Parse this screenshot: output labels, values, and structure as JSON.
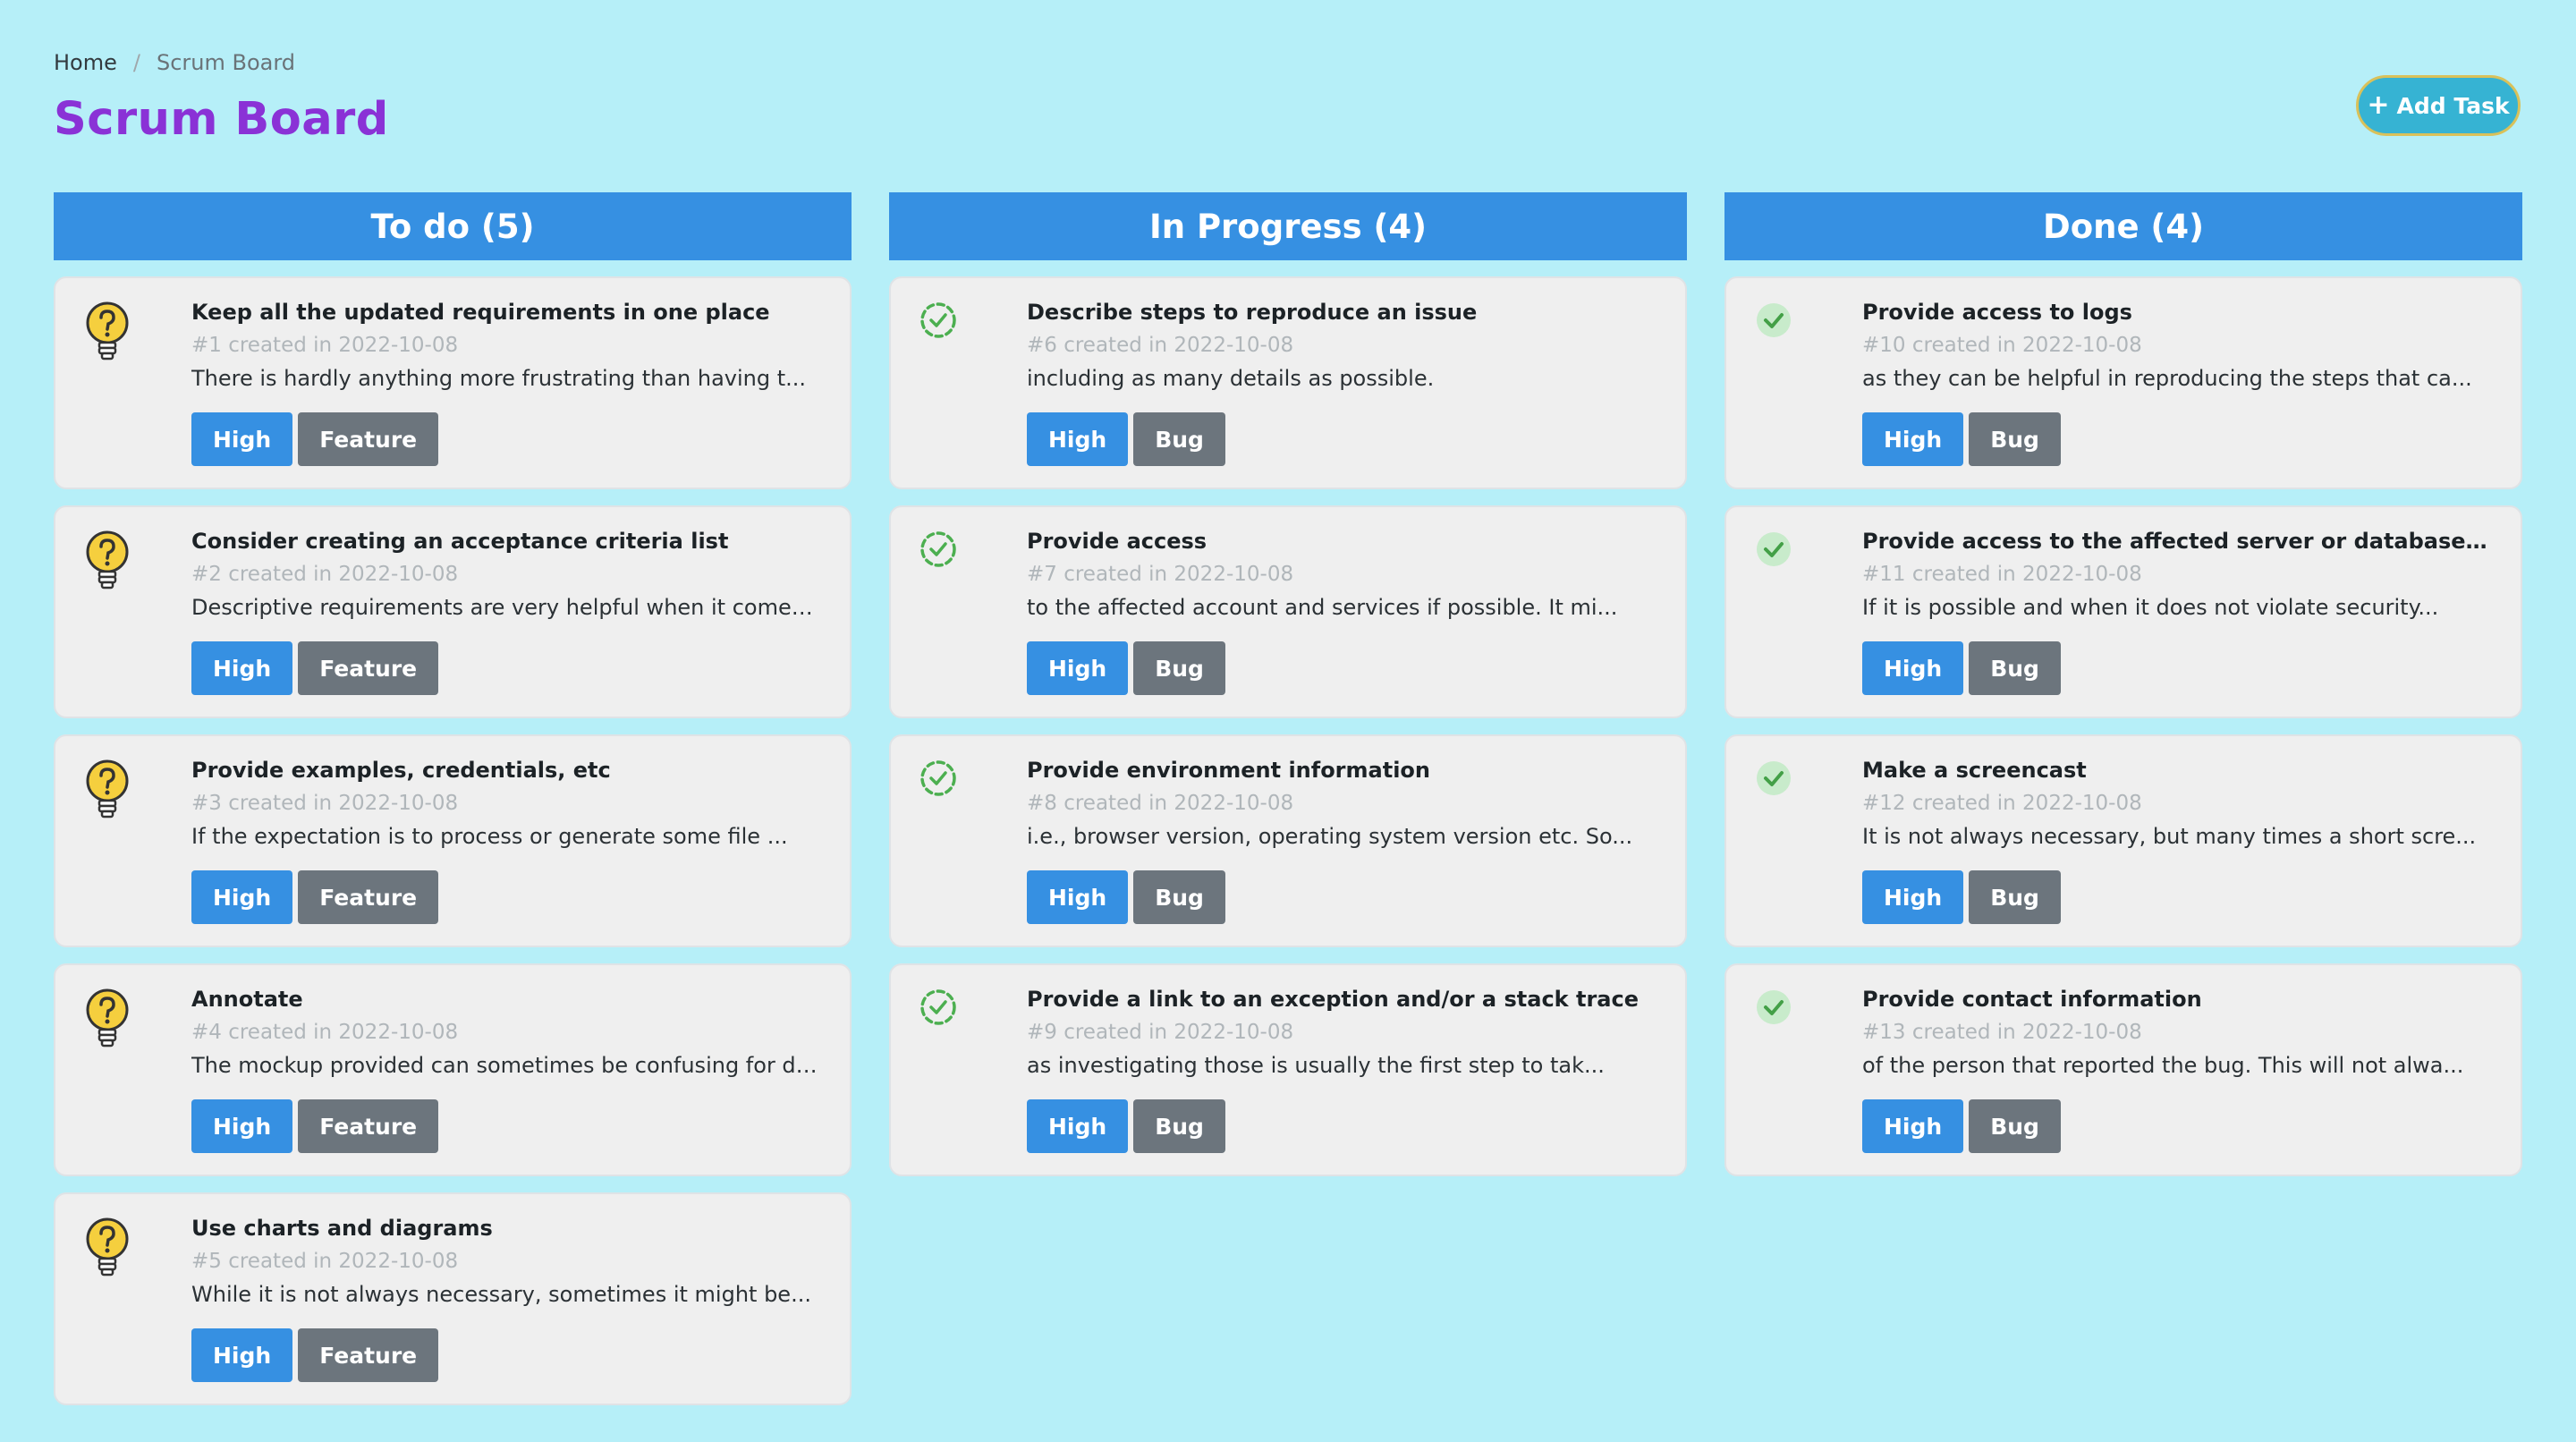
{
  "breadcrumb": {
    "home": "Home",
    "separator": "/",
    "current": "Scrum Board"
  },
  "page_title": "Scrum Board",
  "add_task": {
    "icon": "plus-icon",
    "label": "Add Task"
  },
  "columns": [
    {
      "header": "To do (5)",
      "icon": "lightbulb-question-icon",
      "cards": [
        {
          "title": "Keep all the updated requirements in one place",
          "meta": "#1 created in 2022-10-08",
          "desc": "There is hardly anything more frustrating than having t...",
          "priority": "High",
          "type": "Feature"
        },
        {
          "title": "Consider creating an acceptance criteria list",
          "meta": "#2 created in 2022-10-08",
          "desc": "Descriptive requirements are very helpful when it comes...",
          "priority": "High",
          "type": "Feature"
        },
        {
          "title": "Provide examples, credentials, etc",
          "meta": "#3 created in 2022-10-08",
          "desc": "If the expectation is to process or generate some file ...",
          "priority": "High",
          "type": "Feature"
        },
        {
          "title": "Annotate",
          "meta": "#4 created in 2022-10-08",
          "desc": "The mockup provided can sometimes be confusing for deve...",
          "priority": "High",
          "type": "Feature"
        },
        {
          "title": "Use charts and diagrams",
          "meta": "#5 created in 2022-10-08",
          "desc": "While it is not always necessary, sometimes it might be...",
          "priority": "High",
          "type": "Feature"
        }
      ]
    },
    {
      "header": "In Progress (4)",
      "icon": "in-progress-check-icon",
      "cards": [
        {
          "title": "Describe steps to reproduce an issue",
          "meta": "#6 created in 2022-10-08",
          "desc": "including as many details as possible.",
          "priority": "High",
          "type": "Bug"
        },
        {
          "title": "Provide access",
          "meta": "#7 created in 2022-10-08",
          "desc": "to the affected account and services if possible. It mi...",
          "priority": "High",
          "type": "Bug"
        },
        {
          "title": "Provide environment information",
          "meta": "#8 created in 2022-10-08",
          "desc": "i.e., browser version, operating system version etc. So...",
          "priority": "High",
          "type": "Bug"
        },
        {
          "title": "Provide a link to an exception and/or a stack trace",
          "meta": "#9 created in 2022-10-08",
          "desc": "as investigating those is usually the first step to tak...",
          "priority": "High",
          "type": "Bug"
        }
      ]
    },
    {
      "header": "Done (4)",
      "icon": "check-circle-icon",
      "cards": [
        {
          "title": "Provide access to logs",
          "meta": "#10 created in 2022-10-08",
          "desc": "as they can be helpful in reproducing the steps that ca...",
          "priority": "High",
          "type": "Bug"
        },
        {
          "title": "Provide access to the affected server or database dump",
          "meta": "#11 created in 2022-10-08",
          "desc": "If it is possible and when it does not violate security...",
          "priority": "High",
          "type": "Bug"
        },
        {
          "title": "Make a screencast",
          "meta": "#12 created in 2022-10-08",
          "desc": "It is not always necessary, but many times a short scre...",
          "priority": "High",
          "type": "Bug"
        },
        {
          "title": "Provide contact information",
          "meta": "#13 created in 2022-10-08",
          "desc": "of the person that reported the bug. This will not alwa...",
          "priority": "High",
          "type": "Bug"
        }
      ]
    }
  ],
  "colors": {
    "background": "#b6eff8",
    "title": "#8a32d6",
    "header": "#3690e2",
    "priority_tag": "#3690e2",
    "type_tag": "#6c757d",
    "done_green": "#4caf50",
    "bulb_yellow": "#f5cf3e"
  }
}
